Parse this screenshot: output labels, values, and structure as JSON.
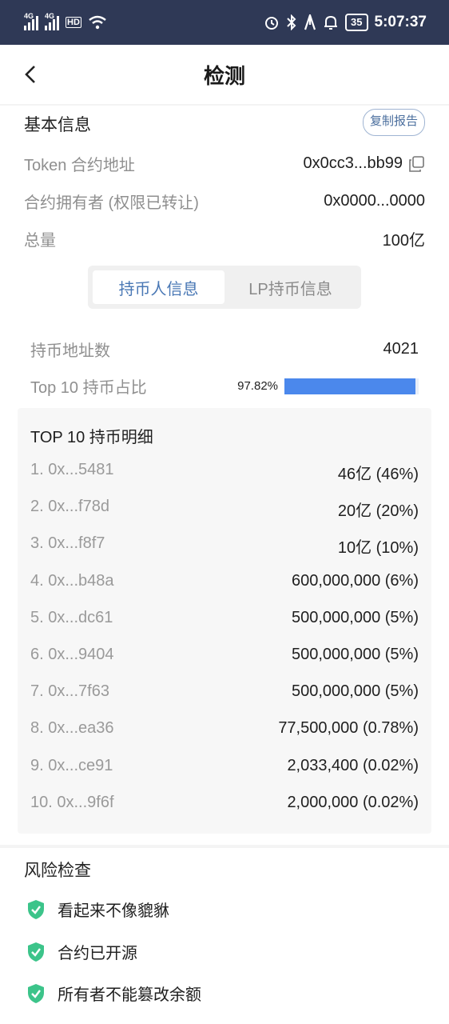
{
  "status_bar": {
    "left_signals": [
      "4G",
      "4G"
    ],
    "hd_label": "HD",
    "battery": "35",
    "time": "5:07:37",
    "icons": [
      "alarm-icon",
      "bluetooth-icon",
      "a-icon",
      "bell-icon"
    ]
  },
  "header": {
    "title": "检测",
    "back_icon": "chevron-left-icon"
  },
  "basic": {
    "section_title": "基本信息",
    "copy_report": "复制报告",
    "rows": [
      {
        "label": "Token 合约地址",
        "value": "0x0cc3...bb99"
      },
      {
        "label": "合约拥有者 (权限已转让)",
        "value": "0x0000...0000"
      },
      {
        "label": "总量",
        "value": "100亿"
      }
    ]
  },
  "tabs": [
    {
      "label": "持币人信息",
      "active": true
    },
    {
      "label": "LP持币信息",
      "active": false
    }
  ],
  "stats": {
    "holder_count_label": "持币地址数",
    "holder_count": "4021",
    "top10_label": "Top 10 持币占比",
    "top10_pct_text": "97.82%",
    "top10_pct": 0.9782
  },
  "top10": {
    "title": "TOP 10 持币明细",
    "rows": [
      {
        "addr": "1. 0x...5481",
        "amount": "46亿 (46%)"
      },
      {
        "addr": "2. 0x...f78d",
        "amount": "20亿 (20%)"
      },
      {
        "addr": "3. 0x...f8f7",
        "amount": "10亿 (10%)"
      },
      {
        "addr": "4. 0x...b48a",
        "amount": "600,000,000 (6%)"
      },
      {
        "addr": "5. 0x...dc61",
        "amount": "500,000,000 (5%)"
      },
      {
        "addr": "6. 0x...9404",
        "amount": "500,000,000 (5%)"
      },
      {
        "addr": "7. 0x...7f63",
        "amount": "500,000,000 (5%)"
      },
      {
        "addr": "8. 0x...ea36",
        "amount": "77,500,000 (0.78%)"
      },
      {
        "addr": "9. 0x...ce91",
        "amount": "2,033,400 (0.02%)"
      },
      {
        "addr": "10. 0x...9f6f",
        "amount": "2,000,000 (0.02%)"
      }
    ]
  },
  "risk": {
    "title": "风险检查",
    "items": [
      "看起来不像貔貅",
      "合约已开源",
      "所有者不能篡改余额"
    ]
  },
  "colors": {
    "status_bar": "#2f3956",
    "accent": "#4a78b5",
    "bar": "#4b88ec",
    "shield": "#3cc48a"
  }
}
